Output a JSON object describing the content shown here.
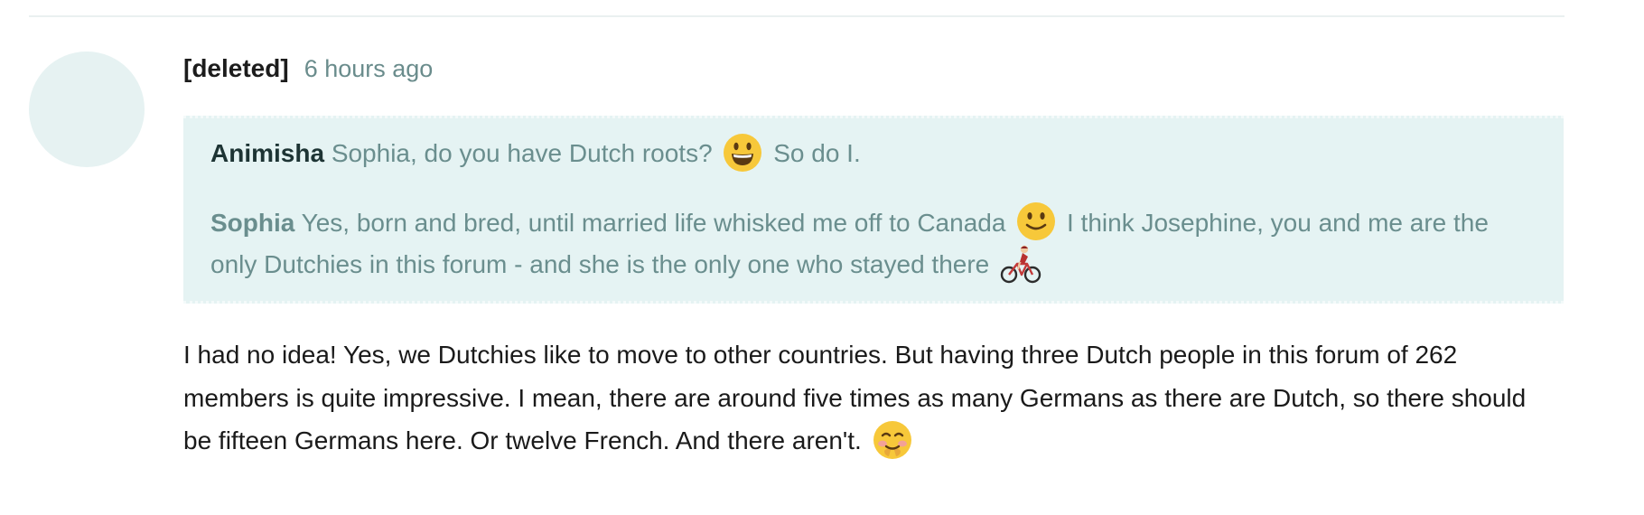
{
  "comment": {
    "author": "[deleted]",
    "timestamp": "6 hours ago",
    "quote": {
      "line1": {
        "author": "Animisha",
        "text_before": "Sophia, do you have Dutch roots?",
        "emoji": "grinning-face-icon",
        "text_after": "So do I."
      },
      "line2": {
        "author": "Sophia",
        "text_before": "Yes, born and bred, until married life whisked me off to Canada",
        "emoji1": "slightly-smiling-face-icon",
        "text_after": "I think Josephine, you and me are the only Dutchies in this forum - and she is the only one who stayed there",
        "emoji2": "person-biking-icon"
      }
    },
    "body": {
      "text": "I had no idea! Yes, we Dutchies like to move to other countries. But having three Dutch people in this forum of 262 members is quite impressive. I mean, there are around five times as many Germans as there are Dutch, so there should be fifteen Germans here. Or twelve French. And there aren't.",
      "emoji": "smiling-face-with-blush-icon"
    }
  },
  "colors": {
    "avatar": "#e6f2f2",
    "quote_background": "#e5f3f3",
    "muted_teal": "#6a8e8e",
    "timestamp": "#6a8c8c"
  }
}
